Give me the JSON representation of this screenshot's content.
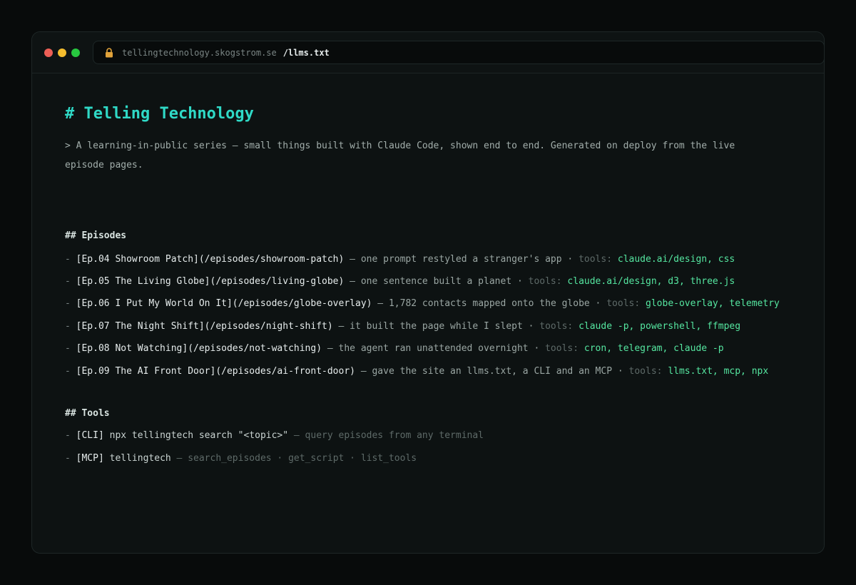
{
  "window": {
    "url_host": "tellingtechnology.skogstrom.se",
    "url_path": "/llms.txt"
  },
  "doc": {
    "title": "# Telling Technology",
    "intro": "> A learning-in-public series — small things built with Claude Code, shown end to end. Generated on deploy from the live episode pages.",
    "episodes_heading": "## Episodes",
    "episodes": [
      {
        "bullet": "- ",
        "link": "[Ep.04 Showroom Patch](/episodes/showroom-patch)",
        "desc": " — one prompt restyled a stranger's app · ",
        "tools_label": "tools: ",
        "tools": "claude.ai/design, css"
      },
      {
        "bullet": "- ",
        "link": "[Ep.05 The Living Globe](/episodes/living-globe)",
        "desc": " — one sentence built a planet · ",
        "tools_label": "tools: ",
        "tools": "claude.ai/design, d3, three.js"
      },
      {
        "bullet": "- ",
        "link": "[Ep.06 I Put My World On It](/episodes/globe-overlay)",
        "desc": " — 1,782 contacts mapped onto the globe · ",
        "tools_label": "tools: ",
        "tools": "globe-overlay, telemetry"
      },
      {
        "bullet": "- ",
        "link": "[Ep.07 The Night Shift](/episodes/night-shift)",
        "desc": " — it built the page while I slept · ",
        "tools_label": "tools: ",
        "tools": "claude -p, powershell, ffmpeg"
      },
      {
        "bullet": "- ",
        "link": "[Ep.08 Not Watching](/episodes/not-watching)",
        "desc": " — the agent ran unattended overnight · ",
        "tools_label": "tools: ",
        "tools": "cron, telegram, claude -p"
      },
      {
        "bullet": "- ",
        "link": "[Ep.09 The AI Front Door](/episodes/ai-front-door)",
        "desc": " — gave the site an llms.txt, a CLI and an MCP · ",
        "tools_label": "tools: ",
        "tools": "llms.txt, mcp, npx"
      }
    ],
    "tools_heading": "## Tools",
    "tools": [
      {
        "bullet": "- ",
        "tag": "[CLI]",
        "cmd": " npx tellingtech search \"<topic>\"",
        "desc": " — query episodes from any terminal"
      },
      {
        "bullet": "- ",
        "tag": "[MCP]",
        "cmd": " tellingtech",
        "desc": " — search_episodes · get_script · list_tools"
      }
    ]
  },
  "icons": {
    "lock": "lock-icon"
  },
  "colors": {
    "accent": "#2fd9c6",
    "tools": "#55e6a0",
    "background": "#0d1212"
  }
}
